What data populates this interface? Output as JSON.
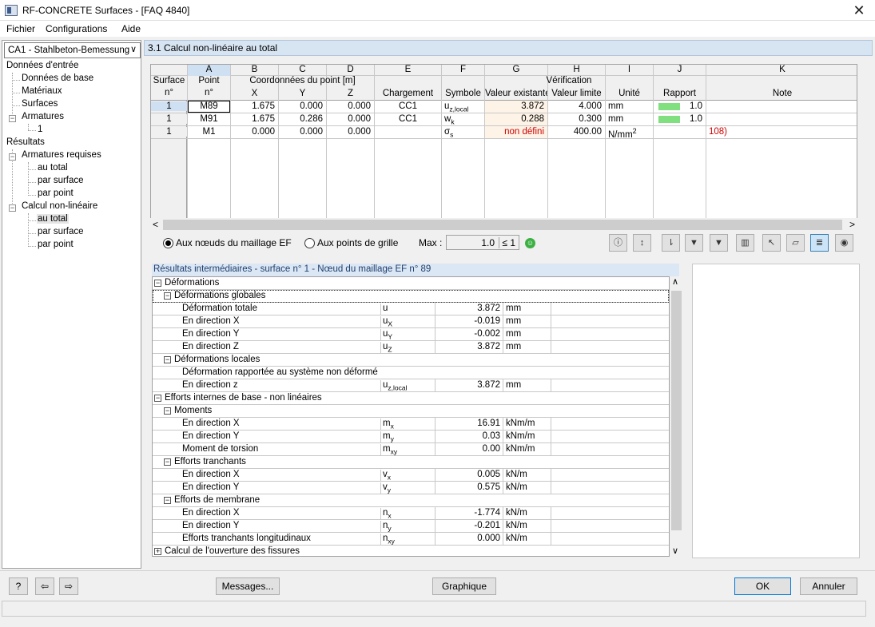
{
  "window": {
    "title": "RF-CONCRETE Surfaces - [FAQ 4840]"
  },
  "menu": [
    "Fichier",
    "Configurations",
    "Aide"
  ],
  "sidebar": {
    "case": "CA1 - Stahlbeton-Bemessung",
    "items": [
      "Données d'entrée",
      "Données de base",
      "Matériaux",
      "Surfaces",
      "Armatures",
      "1",
      "Résultats",
      "Armatures requises",
      "au total",
      "par surface",
      "par point",
      "Calcul non-linéaire",
      "au total",
      "par surface",
      "par point"
    ]
  },
  "section": {
    "title": "3.1 Calcul non-linéaire au total"
  },
  "grid": {
    "col_letters": [
      "A",
      "B",
      "C",
      "D",
      "E",
      "F",
      "G",
      "H",
      "I",
      "J",
      "K"
    ],
    "header1": {
      "surface": "Surface",
      "point": "Point",
      "coords": "Coordonnées du point [m]",
      "verification": "Vérification"
    },
    "header2": {
      "surface": "n°",
      "point": "n°",
      "x": "X",
      "y": "Y",
      "z": "Z",
      "load": "Chargement",
      "symbol": "Symbole",
      "existing": "Valeur existante",
      "limit": "Valeur limite",
      "unit": "Unité",
      "ratio": "Rapport",
      "note": "Note"
    },
    "rows": [
      {
        "surface": "1",
        "point": "M89",
        "x": "1.675",
        "y": "0.000",
        "z": "0.000",
        "load": "CC1",
        "symbol": "u",
        "symbol_sub": "z,local",
        "existing": "3.872",
        "limit": "4.000",
        "unit": "mm",
        "ratio": "1.0",
        "ratio_fill": 0.97,
        "note": ""
      },
      {
        "surface": "1",
        "point": "M91",
        "x": "1.675",
        "y": "0.286",
        "z": "0.000",
        "load": "CC1",
        "symbol": "w",
        "symbol_sub": "k",
        "existing": "0.288",
        "limit": "0.300",
        "unit": "mm",
        "ratio": "1.0",
        "ratio_fill": 0.96,
        "note": ""
      },
      {
        "surface": "1",
        "point": "M1",
        "x": "0.000",
        "y": "0.000",
        "z": "0.000",
        "load": "",
        "symbol": "σ",
        "symbol_sub": "s",
        "existing": "non défini",
        "limit": "400.00",
        "unit": "N/mm",
        "unit_sup": "2",
        "ratio": "",
        "ratio_fill": 0,
        "note": "108)"
      }
    ]
  },
  "options": {
    "radio1": "Aux nœuds du maillage EF",
    "radio2": "Aux points de grille",
    "max_label": "Max :",
    "max_value": "1.0",
    "max_cmp": "≤ 1"
  },
  "results": {
    "title": "Résultats intermédiaires - surface n° 1 - Nœud du maillage EF n° 89",
    "rows": [
      {
        "level": 0,
        "box": "−",
        "label": "Déformations"
      },
      {
        "level": 1,
        "box": "−",
        "label": "Déformations globales",
        "focused": true
      },
      {
        "level": 2,
        "label": "Déformation totale",
        "sym": "u",
        "sub": "",
        "val": "3.872",
        "unit": "mm"
      },
      {
        "level": 2,
        "label": "En direction X",
        "sym": "u",
        "sub": "X",
        "val": "-0.019",
        "unit": "mm"
      },
      {
        "level": 2,
        "label": "En direction Y",
        "sym": "u",
        "sub": "Y",
        "val": "-0.002",
        "unit": "mm"
      },
      {
        "level": 2,
        "label": "En direction Z",
        "sym": "u",
        "sub": "Z",
        "val": "3.872",
        "unit": "mm"
      },
      {
        "level": 1,
        "box": "−",
        "label": "Déformations locales"
      },
      {
        "level": 2,
        "label": "Déformation rapportée au système non déformé",
        "wide": true
      },
      {
        "level": 2,
        "label": "En direction z",
        "sym": "u",
        "sub": "z,local",
        "val": "3.872",
        "unit": "mm"
      },
      {
        "level": 0,
        "box": "−",
        "label": "Efforts internes de base - non linéaires"
      },
      {
        "level": 1,
        "box": "−",
        "label": "Moments"
      },
      {
        "level": 2,
        "label": "En direction X",
        "sym": "m",
        "sub": "x",
        "val": "16.91",
        "unit": "kNm/m"
      },
      {
        "level": 2,
        "label": "En direction Y",
        "sym": "m",
        "sub": "y",
        "val": "0.03",
        "unit": "kNm/m"
      },
      {
        "level": 2,
        "label": "Moment de torsion",
        "sym": "m",
        "sub": "xy",
        "val": "0.00",
        "unit": "kNm/m"
      },
      {
        "level": 1,
        "box": "−",
        "label": "Efforts tranchants"
      },
      {
        "level": 2,
        "label": "En direction X",
        "sym": "v",
        "sub": "x",
        "val": "0.005",
        "unit": "kN/m"
      },
      {
        "level": 2,
        "label": "En direction Y",
        "sym": "v",
        "sub": "y",
        "val": "0.575",
        "unit": "kN/m"
      },
      {
        "level": 1,
        "box": "−",
        "label": "Efforts de membrane"
      },
      {
        "level": 2,
        "label": "En direction X",
        "sym": "n",
        "sub": "x",
        "val": "-1.774",
        "unit": "kN/m"
      },
      {
        "level": 2,
        "label": "En direction Y",
        "sym": "n",
        "sub": "y",
        "val": "-0.201",
        "unit": "kN/m"
      },
      {
        "level": 2,
        "label": "Efforts tranchants longitudinaux",
        "sym": "n",
        "sub": "xy",
        "val": "0.000",
        "unit": "kN/m"
      },
      {
        "level": 0,
        "box": "+",
        "label": "Calcul de l'ouverture des fissures"
      }
    ]
  },
  "buttons": {
    "messages": "Messages...",
    "graphic": "Graphique",
    "ok": "OK",
    "cancel": "Annuler"
  },
  "colors": {
    "header_bg": "#d7e4f2",
    "ratio_bar": "#80e080",
    "error": "#d00000",
    "existing_bg": "#fdf3e6"
  }
}
